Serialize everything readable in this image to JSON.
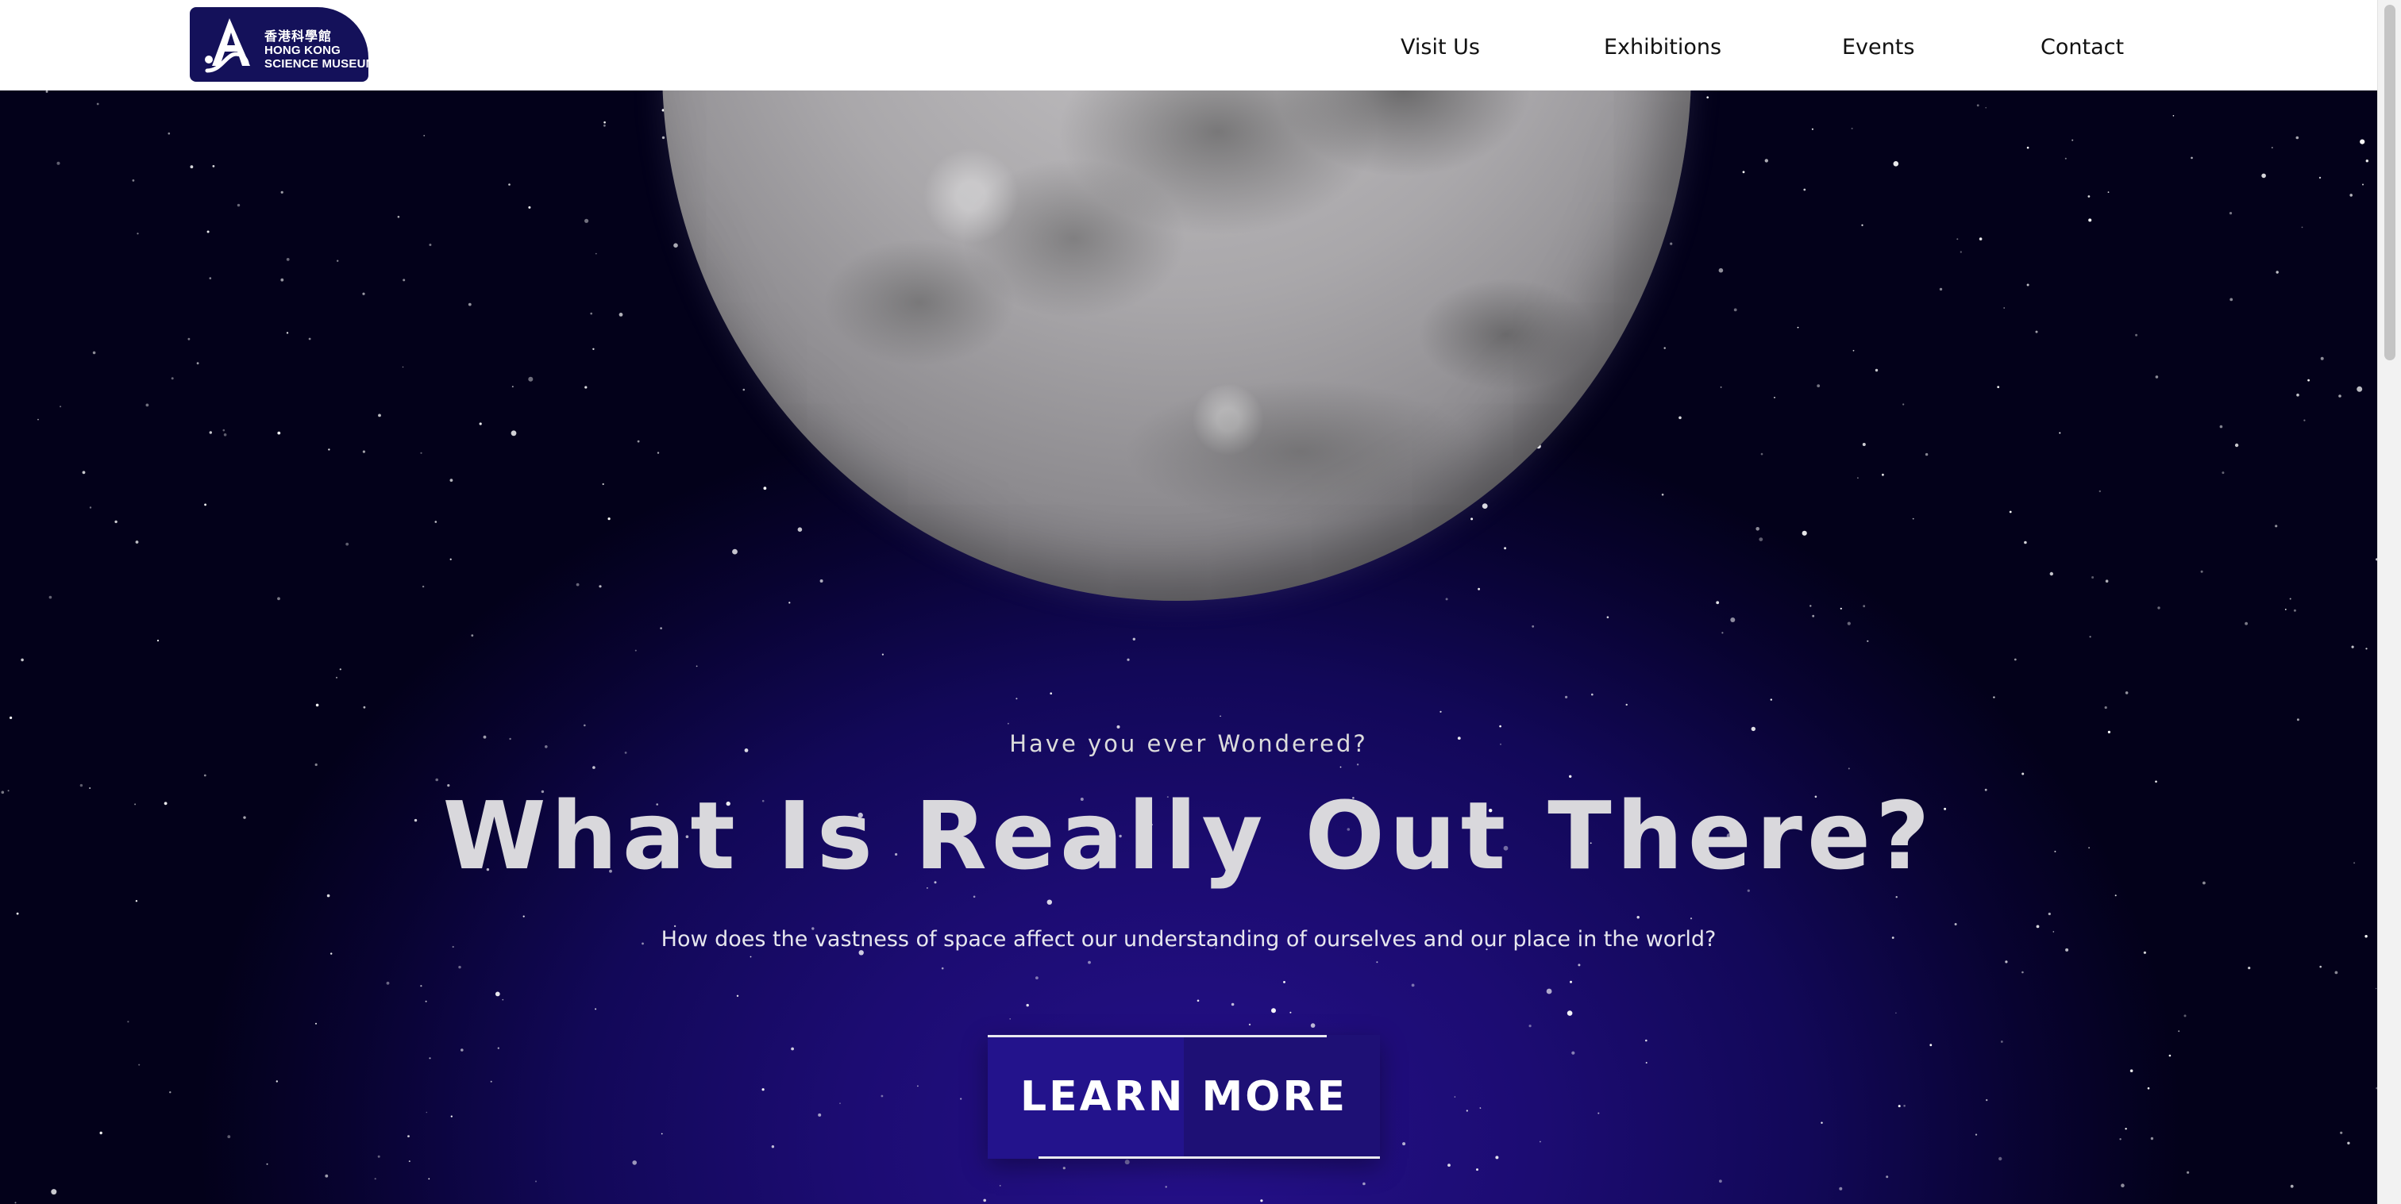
{
  "logo": {
    "name_zh": "香港科學館",
    "name_en_line1": "HONG KONG",
    "name_en_line2": "SCIENCE MUSEUM",
    "icon": "science-museum-logo-mark",
    "color": "#14115a"
  },
  "nav": {
    "items": [
      {
        "label": "Visit Us"
      },
      {
        "label": "Exhibitions"
      },
      {
        "label": "Events"
      },
      {
        "label": "Contact"
      }
    ]
  },
  "hero": {
    "eyebrow": "Have you ever Wondered?",
    "headline": "What Is Really Out There?",
    "subtitle": "How does the vastness of space affect our understanding of ourselves and our place in the world?",
    "cta_label": "LEARN MORE",
    "image": "moon",
    "background_color": "#1c0c72",
    "accent_color": "#23138c"
  }
}
